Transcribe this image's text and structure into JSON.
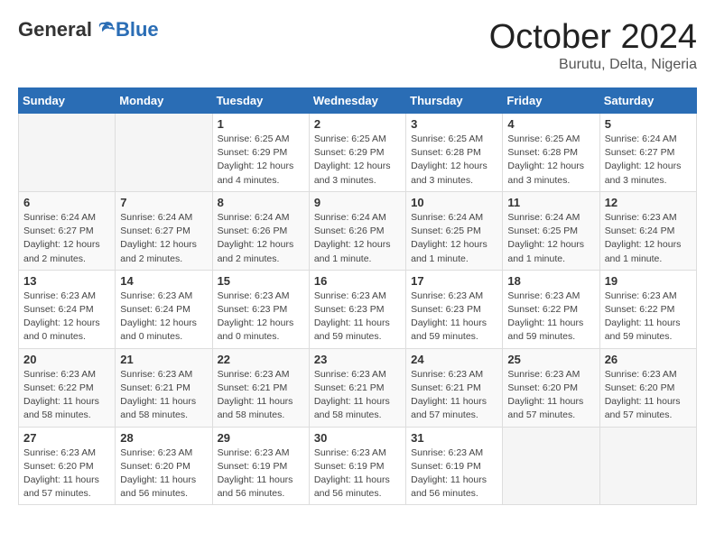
{
  "header": {
    "logo_general": "General",
    "logo_blue": "Blue",
    "month_title": "October 2024",
    "location": "Burutu, Delta, Nigeria"
  },
  "days_of_week": [
    "Sunday",
    "Monday",
    "Tuesday",
    "Wednesday",
    "Thursday",
    "Friday",
    "Saturday"
  ],
  "weeks": [
    [
      {
        "day": "",
        "info": ""
      },
      {
        "day": "",
        "info": ""
      },
      {
        "day": "1",
        "info": "Sunrise: 6:25 AM\nSunset: 6:29 PM\nDaylight: 12 hours and 4 minutes."
      },
      {
        "day": "2",
        "info": "Sunrise: 6:25 AM\nSunset: 6:29 PM\nDaylight: 12 hours and 3 minutes."
      },
      {
        "day": "3",
        "info": "Sunrise: 6:25 AM\nSunset: 6:28 PM\nDaylight: 12 hours and 3 minutes."
      },
      {
        "day": "4",
        "info": "Sunrise: 6:25 AM\nSunset: 6:28 PM\nDaylight: 12 hours and 3 minutes."
      },
      {
        "day": "5",
        "info": "Sunrise: 6:24 AM\nSunset: 6:27 PM\nDaylight: 12 hours and 3 minutes."
      }
    ],
    [
      {
        "day": "6",
        "info": "Sunrise: 6:24 AM\nSunset: 6:27 PM\nDaylight: 12 hours and 2 minutes."
      },
      {
        "day": "7",
        "info": "Sunrise: 6:24 AM\nSunset: 6:27 PM\nDaylight: 12 hours and 2 minutes."
      },
      {
        "day": "8",
        "info": "Sunrise: 6:24 AM\nSunset: 6:26 PM\nDaylight: 12 hours and 2 minutes."
      },
      {
        "day": "9",
        "info": "Sunrise: 6:24 AM\nSunset: 6:26 PM\nDaylight: 12 hours and 1 minute."
      },
      {
        "day": "10",
        "info": "Sunrise: 6:24 AM\nSunset: 6:25 PM\nDaylight: 12 hours and 1 minute."
      },
      {
        "day": "11",
        "info": "Sunrise: 6:24 AM\nSunset: 6:25 PM\nDaylight: 12 hours and 1 minute."
      },
      {
        "day": "12",
        "info": "Sunrise: 6:23 AM\nSunset: 6:24 PM\nDaylight: 12 hours and 1 minute."
      }
    ],
    [
      {
        "day": "13",
        "info": "Sunrise: 6:23 AM\nSunset: 6:24 PM\nDaylight: 12 hours and 0 minutes."
      },
      {
        "day": "14",
        "info": "Sunrise: 6:23 AM\nSunset: 6:24 PM\nDaylight: 12 hours and 0 minutes."
      },
      {
        "day": "15",
        "info": "Sunrise: 6:23 AM\nSunset: 6:23 PM\nDaylight: 12 hours and 0 minutes."
      },
      {
        "day": "16",
        "info": "Sunrise: 6:23 AM\nSunset: 6:23 PM\nDaylight: 11 hours and 59 minutes."
      },
      {
        "day": "17",
        "info": "Sunrise: 6:23 AM\nSunset: 6:23 PM\nDaylight: 11 hours and 59 minutes."
      },
      {
        "day": "18",
        "info": "Sunrise: 6:23 AM\nSunset: 6:22 PM\nDaylight: 11 hours and 59 minutes."
      },
      {
        "day": "19",
        "info": "Sunrise: 6:23 AM\nSunset: 6:22 PM\nDaylight: 11 hours and 59 minutes."
      }
    ],
    [
      {
        "day": "20",
        "info": "Sunrise: 6:23 AM\nSunset: 6:22 PM\nDaylight: 11 hours and 58 minutes."
      },
      {
        "day": "21",
        "info": "Sunrise: 6:23 AM\nSunset: 6:21 PM\nDaylight: 11 hours and 58 minutes."
      },
      {
        "day": "22",
        "info": "Sunrise: 6:23 AM\nSunset: 6:21 PM\nDaylight: 11 hours and 58 minutes."
      },
      {
        "day": "23",
        "info": "Sunrise: 6:23 AM\nSunset: 6:21 PM\nDaylight: 11 hours and 58 minutes."
      },
      {
        "day": "24",
        "info": "Sunrise: 6:23 AM\nSunset: 6:21 PM\nDaylight: 11 hours and 57 minutes."
      },
      {
        "day": "25",
        "info": "Sunrise: 6:23 AM\nSunset: 6:20 PM\nDaylight: 11 hours and 57 minutes."
      },
      {
        "day": "26",
        "info": "Sunrise: 6:23 AM\nSunset: 6:20 PM\nDaylight: 11 hours and 57 minutes."
      }
    ],
    [
      {
        "day": "27",
        "info": "Sunrise: 6:23 AM\nSunset: 6:20 PM\nDaylight: 11 hours and 57 minutes."
      },
      {
        "day": "28",
        "info": "Sunrise: 6:23 AM\nSunset: 6:20 PM\nDaylight: 11 hours and 56 minutes."
      },
      {
        "day": "29",
        "info": "Sunrise: 6:23 AM\nSunset: 6:19 PM\nDaylight: 11 hours and 56 minutes."
      },
      {
        "day": "30",
        "info": "Sunrise: 6:23 AM\nSunset: 6:19 PM\nDaylight: 11 hours and 56 minutes."
      },
      {
        "day": "31",
        "info": "Sunrise: 6:23 AM\nSunset: 6:19 PM\nDaylight: 11 hours and 56 minutes."
      },
      {
        "day": "",
        "info": ""
      },
      {
        "day": "",
        "info": ""
      }
    ]
  ]
}
